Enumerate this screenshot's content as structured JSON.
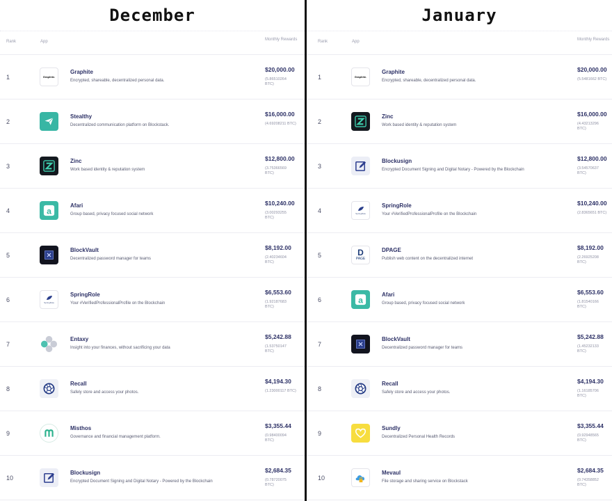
{
  "columns": {
    "rank": "Rank",
    "app": "App",
    "rewards": "Monthly Rewards"
  },
  "december": {
    "title": "December",
    "rows": [
      {
        "rank": "1",
        "name": "Graphite",
        "desc": "Encrypted, shareable, decentralized personal data.",
        "usd": "$20,000.00",
        "btc": "(5.86510264 BTC)",
        "icon": "graphite-logo-icon"
      },
      {
        "rank": "2",
        "name": "Stealthy",
        "desc": "Decentralized communication platform on Blockstack.",
        "usd": "$16,000.00",
        "btc": "(4.69208211 BTC)",
        "icon": "paper-plane-icon"
      },
      {
        "rank": "3",
        "name": "Zinc",
        "desc": "Work based identity & reputation system",
        "usd": "$12,800.00",
        "btc": "(3.75366569 BTC)",
        "icon": "zinc-z-icon"
      },
      {
        "rank": "4",
        "name": "Afari",
        "desc": "Group based, privacy focused social network",
        "usd": "$10,240.00",
        "btc": "(3.00293255 BTC)",
        "icon": "afari-a-icon"
      },
      {
        "rank": "5",
        "name": "BlockVault",
        "desc": "Decentralized password manager for teams",
        "usd": "$8,192.00",
        "btc": "(2.40234604 BTC)",
        "icon": "vault-icon"
      },
      {
        "rank": "6",
        "name": "SpringRole",
        "desc": "Your #VerifiedProfessionalProfile on the Blockchain",
        "usd": "$6,553.60",
        "btc": "(1.92187683 BTC)",
        "icon": "springrole-leaf-icon"
      },
      {
        "rank": "7",
        "name": "Entaxy",
        "desc": "Insight into your finances, without sacrificing your data",
        "usd": "$5,242.88",
        "btc": "(1.53750147 BTC)",
        "icon": "entaxy-circles-icon"
      },
      {
        "rank": "8",
        "name": "Recall",
        "desc": "Safely store and access your photos.",
        "usd": "$4,194.30",
        "btc": "(1.23000117 BTC)",
        "icon": "camera-aperture-icon"
      },
      {
        "rank": "9",
        "name": "Misthos",
        "desc": "Governance and financial management platform.",
        "usd": "$3,355.44",
        "btc": "(0.98400094 BTC)",
        "icon": "misthos-m-icon"
      },
      {
        "rank": "10",
        "name": "Blockusign",
        "desc": "Encrypted Document Signing and Digital Notary - Powered by the Blockchain",
        "usd": "$2,684.35",
        "btc": "(0.78720075 BTC)",
        "icon": "sign-pen-icon"
      }
    ]
  },
  "january": {
    "title": "January",
    "rows": [
      {
        "rank": "1",
        "name": "Graphite",
        "desc": "Encrypted, shareable, decentralized personal data.",
        "usd": "$20,000.00",
        "btc": "(5.5481662 BTC)",
        "icon": "graphite-logo-icon"
      },
      {
        "rank": "2",
        "name": "Zinc",
        "desc": "Work based identity & reputation system",
        "usd": "$16,000.00",
        "btc": "(4.43213296 BTC)",
        "icon": "zinc-z-icon"
      },
      {
        "rank": "3",
        "name": "Blockusign",
        "desc": "Encrypted Document Signing and Digital Notary - Powered by the Blockchain",
        "usd": "$12,800.00",
        "btc": "(3.54570637 BTC)",
        "icon": "sign-pen-icon"
      },
      {
        "rank": "4",
        "name": "SpringRole",
        "desc": "Your #VerifiedProfessionalProfile on the Blockchain",
        "usd": "$10,240.00",
        "btc": "(2.8365651 BTC)",
        "icon": "springrole-leaf-icon"
      },
      {
        "rank": "5",
        "name": "DPAGE",
        "desc": "Publish web content on the decentralized internet",
        "usd": "$8,192.00",
        "btc": "(2.26925208 BTC)",
        "icon": "dpage-logo-icon"
      },
      {
        "rank": "6",
        "name": "Afari",
        "desc": "Group based, privacy focused social network",
        "usd": "$6,553.60",
        "btc": "(1.81540166 BTC)",
        "icon": "afari-a-icon"
      },
      {
        "rank": "7",
        "name": "BlockVault",
        "desc": "Decentralized password manager for teams",
        "usd": "$5,242.88",
        "btc": "(1.45232133 BTC)",
        "icon": "vault-icon"
      },
      {
        "rank": "8",
        "name": "Recall",
        "desc": "Safely store and access your photos.",
        "usd": "$4,194.30",
        "btc": "(1.16185706 BTC)",
        "icon": "camera-aperture-icon"
      },
      {
        "rank": "9",
        "name": "Sundly",
        "desc": "Decentralized Personal Health Records",
        "usd": "$3,355.44",
        "btc": "(0.92948565 BTC)",
        "icon": "heart-icon"
      },
      {
        "rank": "10",
        "name": "Mevaul",
        "desc": "File storage and sharing service on Blockstack",
        "usd": "$2,684.35",
        "btc": "(0.74358852 BTC)",
        "icon": "cloud-lock-icon"
      }
    ]
  },
  "logo_text": {
    "graphite": "Graphite.",
    "springrole": "SpringRole",
    "dpage_mark": "D",
    "dpage_word": "PAGE"
  },
  "colors": {
    "title": "#2d3166",
    "accent_teal": "#38b6a4",
    "divider": "#111111"
  }
}
